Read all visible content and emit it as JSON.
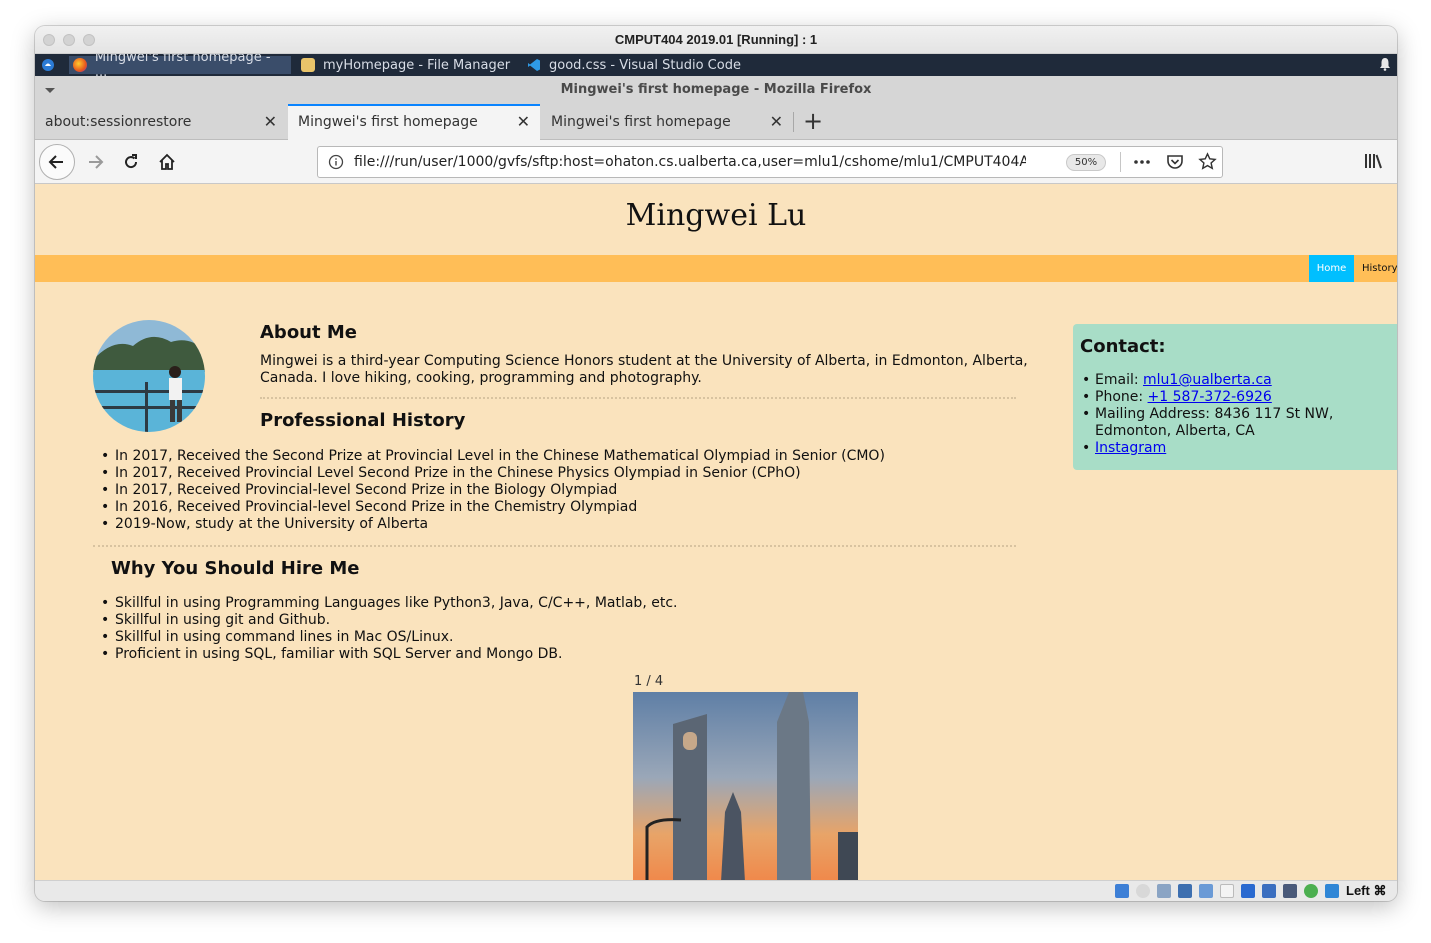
{
  "mac_window": {
    "title": "CMPUT404 2019.01 [Running] : 1"
  },
  "taskbar": {
    "items": [
      {
        "label": "Mingwei's first homepage - ...",
        "icon": "firefox-icon"
      },
      {
        "label": "myHomepage - File Manager",
        "icon": "folder-icon"
      },
      {
        "label": "good.css - Visual Studio Code",
        "icon": "vscode-icon"
      }
    ]
  },
  "firefox": {
    "window_title": "Mingwei's first homepage - Mozilla Firefox",
    "tabs": [
      {
        "label": "about:sessionrestore",
        "selected": false
      },
      {
        "label": "Mingwei's first homepage",
        "selected": true
      },
      {
        "label": "Mingwei's first homepage",
        "selected": false
      }
    ],
    "url": "file:///run/user/1000/gvfs/sftp:host=ohaton.cs.ualberta.ca,user=mlu1/cshome/mlu1/CMPUT404Ass/Ass3/CM",
    "zoom": "50%"
  },
  "page": {
    "site_title": "Mingwei Lu",
    "nav": {
      "home": "Home",
      "history": "History"
    },
    "about": {
      "title": "About Me",
      "text": "Mingwei is a third-year Computing Science Honors student at the University of Alberta, in Edmonton, Alberta, Canada. I love hiking, cooking, programming and photography."
    },
    "history": {
      "title": "Professional History",
      "items": [
        "In 2017, Received the Second Prize at Provincial Level in the Chinese Mathematical Olympiad in Senior (CMO)",
        "In 2017, Received Provincial Level Second Prize in the Chinese Physics Olympiad in Senior (CPhO)",
        "In 2017, Received Provincial-level Second Prize in the Biology Olympiad",
        "In 2016, Received Provincial-level Second Prize in the Chemistry Olympiad",
        "2019-Now, study at the University of Alberta"
      ]
    },
    "hire": {
      "title": "Why You Should Hire Me",
      "items": [
        "Skillful in using Programming Languages like Python3, Java, C/C++, Matlab, etc.",
        "Skillful in using git and Github.",
        "Skillful in using command lines in Mac OS/Linux.",
        "Proficient in using SQL, familiar with SQL Server and Mongo DB."
      ]
    },
    "contact": {
      "title": "Contact:",
      "email_label": "Email: ",
      "email": "mlu1@ualberta.ca",
      "phone_label": "Phone: ",
      "phone": "+1 587-372-6926",
      "address": "Mailing Address: 8436 117 St NW, Edmonton, Alberta, CA",
      "instagram": "Instagram"
    },
    "slideshow": {
      "counter": "1 / 4"
    }
  },
  "vm_status": {
    "host_key": "Left ⌘"
  },
  "colors": {
    "page_bg": "#fae3bd",
    "nav_bar": "#ffbe57",
    "nav_active": "#00bfff",
    "contact_bg": "#a8ddc7",
    "tab_accent": "#0a84ff"
  }
}
